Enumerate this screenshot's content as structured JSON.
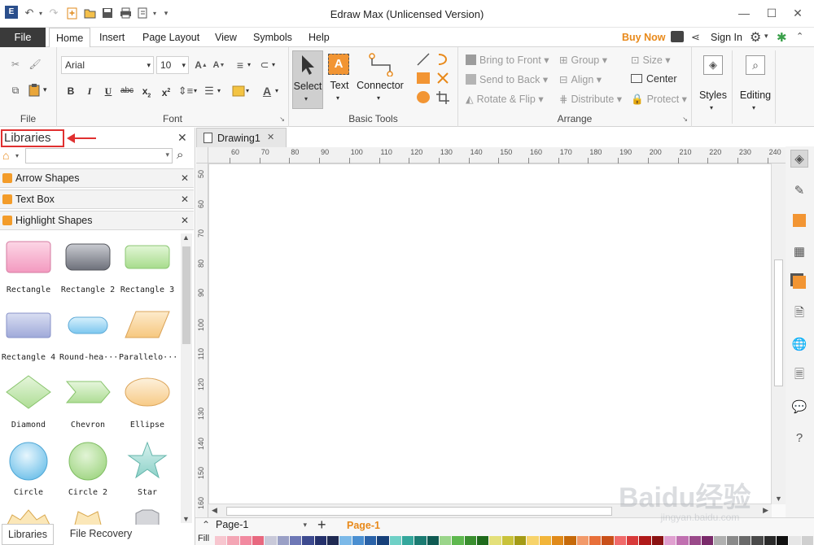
{
  "window": {
    "title": "Edraw Max (Unlicensed Version)"
  },
  "menu": {
    "file": "File",
    "tabs": [
      "Home",
      "Insert",
      "Page Layout",
      "View",
      "Symbols",
      "Help"
    ],
    "buy_now": "Buy Now",
    "sign_in": "Sign In"
  },
  "ribbon": {
    "file_group_label": "File",
    "font": {
      "family": "Arial",
      "size": "10",
      "group_label": "Font"
    },
    "basic_tools": {
      "select": "Select",
      "text": "Text",
      "connector": "Connector",
      "group_label": "Basic Tools"
    },
    "arrange": {
      "bring_to_front": "Bring to Front",
      "send_to_back": "Send to Back",
      "rotate_flip": "Rotate & Flip",
      "group": "Group",
      "align": "Align",
      "distribute": "Distribute",
      "size": "Size",
      "center": "Center",
      "protect": "Protect",
      "group_label": "Arrange"
    },
    "styles": "Styles",
    "editing": "Editing"
  },
  "libraries": {
    "title": "Libraries",
    "categories": [
      "Arrow Shapes",
      "Text Box",
      "Highlight Shapes"
    ],
    "shapes": [
      "Rectangle",
      "Rectangle 2",
      "Rectangle 3",
      "Rectangle 4",
      "Round-hea···",
      "Parallelo···",
      "Diamond",
      "Chevron",
      "Ellipse",
      "Circle",
      "Circle 2",
      "Star"
    ],
    "bottom_tabs": [
      "Libraries",
      "File Recovery"
    ]
  },
  "document": {
    "tab": "Drawing1",
    "ruler_top": [
      "60",
      "70",
      "80",
      "90",
      "100",
      "110",
      "120",
      "130",
      "140",
      "150",
      "160",
      "170",
      "180",
      "190",
      "200",
      "210",
      "220",
      "230",
      "240"
    ],
    "ruler_left": [
      "50",
      "60",
      "70",
      "80",
      "90",
      "100",
      "110",
      "120",
      "130",
      "140",
      "150",
      "160"
    ]
  },
  "pages": {
    "selector": "Page-1",
    "active": "Page-1",
    "fill_label": "Fill"
  },
  "colors": {
    "accent": "#e8891a",
    "file_tab": "#3a3a3a",
    "highlight": "#e03030"
  },
  "watermark": {
    "line1": "Baidu经验",
    "line2": "jingyan.baidu.com"
  }
}
